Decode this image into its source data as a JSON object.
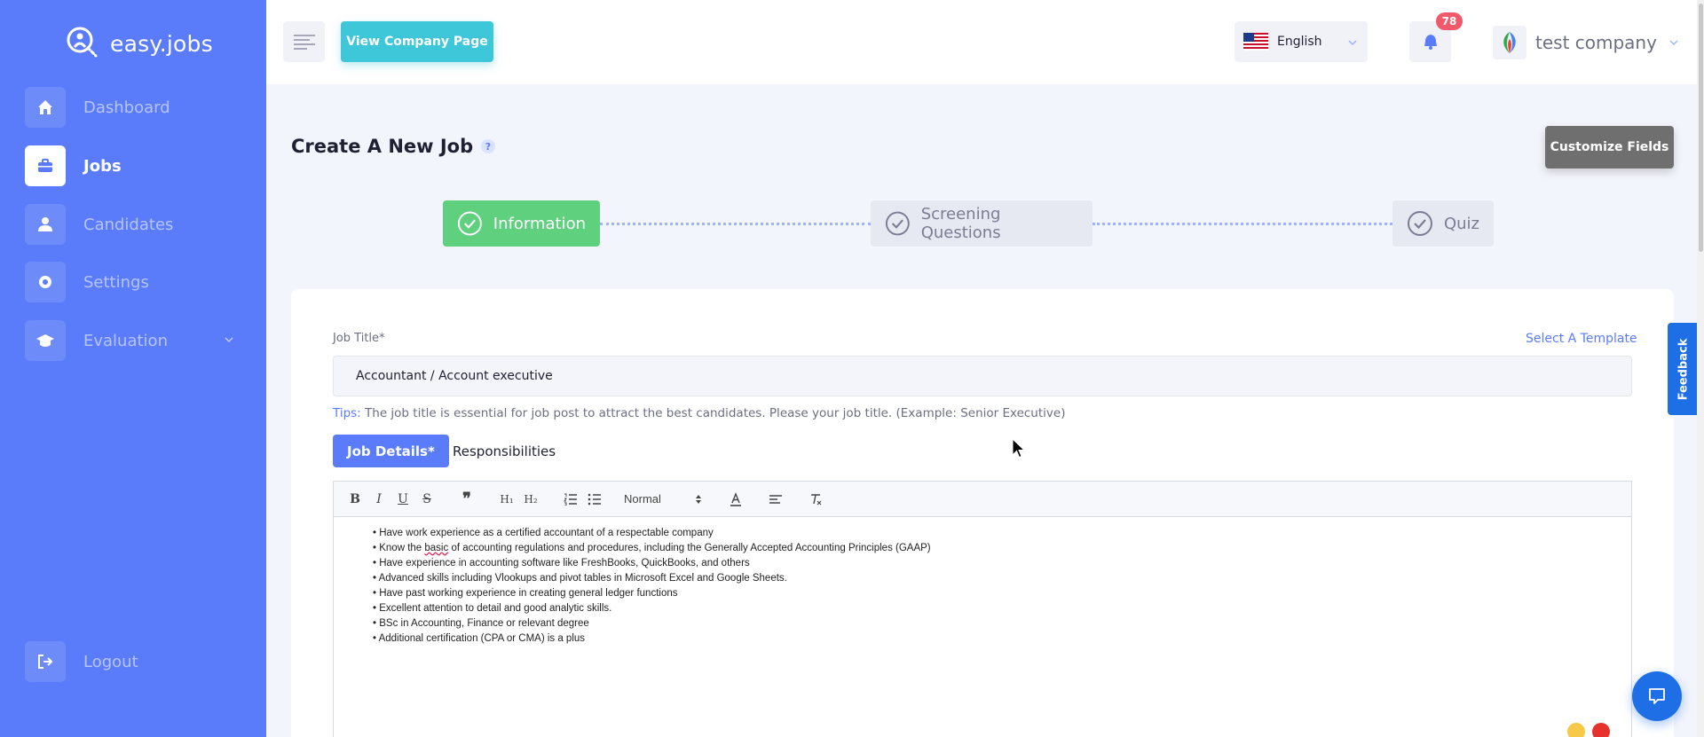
{
  "app": {
    "name": "easy.jobs",
    "brand_color": "#5b7cfa"
  },
  "sidebar": {
    "items": [
      {
        "label": "Dashboard",
        "icon": "home-icon",
        "active": false
      },
      {
        "label": "Jobs",
        "icon": "briefcase-icon",
        "active": true
      },
      {
        "label": "Candidates",
        "icon": "user-icon",
        "active": false
      },
      {
        "label": "Settings",
        "icon": "gear-icon",
        "active": false
      },
      {
        "label": "Evaluation",
        "icon": "graduation-cap-icon",
        "active": false
      }
    ],
    "logout_label": "Logout"
  },
  "header": {
    "view_company_label": "View Company Page",
    "language": "English",
    "notification_count": "78",
    "company_name": "test company"
  },
  "page": {
    "title": "Create A New Job",
    "customize_label": "Customize Fields",
    "steps": [
      {
        "label": "Information",
        "state": "complete"
      },
      {
        "label": "Screening Questions",
        "state": "pending"
      },
      {
        "label": "Quiz",
        "state": "pending"
      }
    ]
  },
  "form": {
    "job_title_label": "Job Title*",
    "select_template_label": "Select A Template",
    "job_title_value": "Accountant / Account executive",
    "tips_key": "Tips:",
    "tips_text": " The job title is essential for job post to attract the best candidates. Please your job title. (Example: Senior Executive)",
    "tabs": [
      {
        "label": "Job Details*",
        "active": true
      },
      {
        "label": "Responsibilities",
        "active": false
      }
    ],
    "editor": {
      "format_select": "Normal",
      "lines": [
        "Have work experience as a certified accountant of a respectable company",
        "Know the basic of accounting regulations and procedures, including the Generally Accepted Accounting Principles (GAAP)",
        "Have experience in accounting software like FreshBooks, QuickBooks, and others",
        "Advanced skills including Vlookups and pivot tables in Microsoft Excel and Google Sheets.",
        "Have past working experience in creating general ledger functions",
        "Excellent attention to detail and good analytic skills.",
        "BSc in Accounting, Finance or relevant degree",
        "Additional certification (CPA or CMA) is a plus"
      ]
    }
  },
  "feedback_label": "Feedback"
}
